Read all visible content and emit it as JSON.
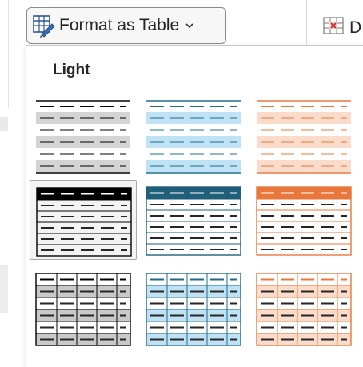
{
  "ribbon": {
    "format_as_table": {
      "label": "Format as Table",
      "icon": "format-as-table-icon",
      "dropdown_icon": "chevron-down-icon"
    },
    "adjacent_button": {
      "icon": "table-delete-icon",
      "partial_label": "D"
    }
  },
  "gallery": {
    "section_title": "Light",
    "styles": [
      {
        "id": "light-1",
        "kind": "banded-rows",
        "color": "#000000",
        "band": "#d4d4d4",
        "selected": false
      },
      {
        "id": "light-2",
        "kind": "banded-rows",
        "color": "#1f6b8e",
        "band": "#bfe3f4",
        "selected": false
      },
      {
        "id": "light-3",
        "kind": "banded-rows",
        "color": "#e9773b",
        "band": "#fbdccb",
        "selected": false
      },
      {
        "id": "light-8",
        "kind": "header-grid",
        "color": "#000000",
        "band": "#ffffff",
        "selected": true
      },
      {
        "id": "light-9",
        "kind": "header-grid",
        "color": "#1f5f7a",
        "band": "#ffffff",
        "selected": false
      },
      {
        "id": "light-10",
        "kind": "header-grid",
        "color": "#e9773b",
        "band": "#ffffff",
        "selected": false
      },
      {
        "id": "light-15",
        "kind": "full-grid",
        "color": "#000000",
        "band": "#c9c9c9",
        "selected": false
      },
      {
        "id": "light-16",
        "kind": "full-grid",
        "color": "#1f6b8e",
        "band": "#bfe3f4",
        "selected": false
      },
      {
        "id": "light-17",
        "kind": "full-grid",
        "color": "#e9773b",
        "band": "#fbdccb",
        "selected": false
      }
    ]
  }
}
